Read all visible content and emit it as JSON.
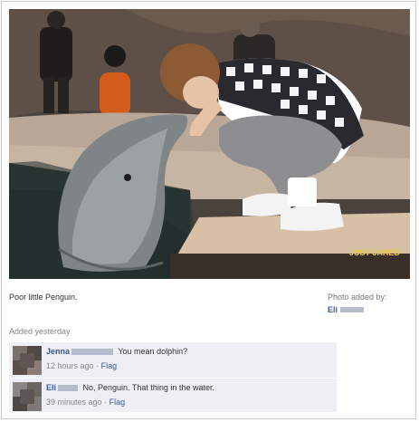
{
  "photo": {
    "watermark": "JUST JARED",
    "description_icon": "photo"
  },
  "caption": "Poor little Penguin.",
  "photo_added_by": {
    "label": "Photo added by:",
    "name": "Eli"
  },
  "added_time": "Added yesterday",
  "comments": [
    {
      "name": "Jenna",
      "text": "You mean dolphin?",
      "time": "12 hours ago",
      "separator": "·",
      "action": "Flag"
    },
    {
      "name": "Eli",
      "text": "No, Penguin. That thing in the water.",
      "time": "39 minutes ago",
      "separator": "·",
      "action": "Flag"
    }
  ],
  "colors": {
    "link": "#3b5998",
    "comment_bg": "#edeff4",
    "muted": "#888888"
  }
}
